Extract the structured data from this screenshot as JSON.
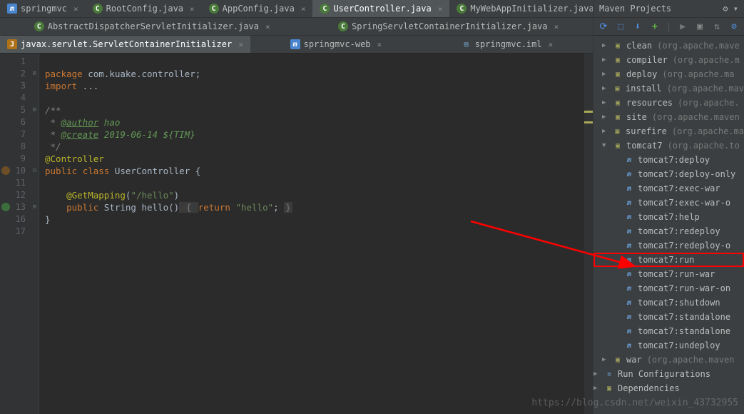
{
  "tabs_row1": [
    {
      "icon": "m",
      "label": "springmvc",
      "active": false,
      "close": true
    },
    {
      "icon": "c",
      "label": "RootConfig.java",
      "active": false,
      "close": true
    },
    {
      "icon": "c",
      "label": "AppConfig.java",
      "active": false,
      "close": true
    },
    {
      "icon": "c",
      "label": "UserController.java",
      "active": true,
      "close": true
    },
    {
      "icon": "c",
      "label": "MyWebAppInitializer.java",
      "active": false,
      "close": true
    }
  ],
  "tabs_row2": [
    {
      "icon": "c",
      "label": "AbstractDispatcherServletInitializer.java",
      "active": false,
      "close": true
    },
    {
      "icon": "c",
      "label": "SpringServletContainerInitializer.java",
      "active": false,
      "close": true
    }
  ],
  "tabs_row3": [
    {
      "icon": "j",
      "label": "javax.servlet.ServletContainerInitializer",
      "active": true,
      "close": true
    },
    {
      "icon": "m",
      "label": "springmvc-web",
      "active": false,
      "close": true
    },
    {
      "icon": "f",
      "label": "springmvc.iml",
      "active": false,
      "close": true
    }
  ],
  "code": {
    "l1_kw": "package",
    "l1_rest": " com.kuake.controller;",
    "l3_kw": "import",
    "l3_rest": " ...",
    "l5": "/**",
    "l6_pre": " * ",
    "l6_tag": "@author",
    "l6_val": " hao",
    "l7_pre": " * ",
    "l7_tag": "@create",
    "l7_val": " 2019-06-14 ${TIM}",
    "l8": " */",
    "l9": "@Controller",
    "l10_kw1": "public",
    "l10_kw2": "class",
    "l10_name": "UserController",
    "l10_brace": " {",
    "l12_ann": "@GetMapping",
    "l12_args": "(\"/hello\")",
    "l13_kw1": "public",
    "l13_ret": "String",
    "l13_name": "hello",
    "l13_p": "()",
    "l13_b1": " { ",
    "l13_kw2": "return",
    "l13_str": " \"hello\"",
    "l13_sc": "; ",
    "l13_b2": "}",
    "l16": "}"
  },
  "lines": [
    "1",
    "2",
    "3",
    "4",
    "5",
    "6",
    "7",
    "8",
    "9",
    "10",
    "11",
    "12",
    "13",
    "16",
    "17"
  ],
  "maven": {
    "title": "Maven Projects",
    "tools_gear": "⚙",
    "items": [
      {
        "indent": 0,
        "arrow": "▶",
        "icon": "pkg",
        "label": "clean",
        "pkg": "(org.apache.mave"
      },
      {
        "indent": 0,
        "arrow": "▶",
        "icon": "pkg",
        "label": "compiler",
        "pkg": "(org.apache.m"
      },
      {
        "indent": 0,
        "arrow": "▶",
        "icon": "pkg",
        "label": "deploy",
        "pkg": "(org.apache.ma"
      },
      {
        "indent": 0,
        "arrow": "▶",
        "icon": "pkg",
        "label": "install",
        "pkg": "(org.apache.mav"
      },
      {
        "indent": 0,
        "arrow": "▶",
        "icon": "pkg",
        "label": "resources",
        "pkg": "(org.apache."
      },
      {
        "indent": 0,
        "arrow": "▶",
        "icon": "pkg",
        "label": "site",
        "pkg": "(org.apache.maven"
      },
      {
        "indent": 0,
        "arrow": "▶",
        "icon": "pkg",
        "label": "surefire",
        "pkg": "(org.apache.ma"
      },
      {
        "indent": 0,
        "arrow": "▼",
        "icon": "pkg",
        "label": "tomcat7",
        "pkg": "(org.apache.to"
      },
      {
        "indent": 1,
        "arrow": "",
        "icon": "m",
        "label": "tomcat7:deploy",
        "pkg": ""
      },
      {
        "indent": 1,
        "arrow": "",
        "icon": "m",
        "label": "tomcat7:deploy-only",
        "pkg": ""
      },
      {
        "indent": 1,
        "arrow": "",
        "icon": "m",
        "label": "tomcat7:exec-war",
        "pkg": ""
      },
      {
        "indent": 1,
        "arrow": "",
        "icon": "m",
        "label": "tomcat7:exec-war-o",
        "pkg": ""
      },
      {
        "indent": 1,
        "arrow": "",
        "icon": "m",
        "label": "tomcat7:help",
        "pkg": ""
      },
      {
        "indent": 1,
        "arrow": "",
        "icon": "m",
        "label": "tomcat7:redeploy",
        "pkg": ""
      },
      {
        "indent": 1,
        "arrow": "",
        "icon": "m",
        "label": "tomcat7:redeploy-o",
        "pkg": ""
      },
      {
        "indent": 1,
        "arrow": "",
        "icon": "m",
        "label": "tomcat7:run",
        "pkg": "",
        "highlight": true
      },
      {
        "indent": 1,
        "arrow": "",
        "icon": "m",
        "label": "tomcat7:run-war",
        "pkg": ""
      },
      {
        "indent": 1,
        "arrow": "",
        "icon": "m",
        "label": "tomcat7:run-war-on",
        "pkg": ""
      },
      {
        "indent": 1,
        "arrow": "",
        "icon": "m",
        "label": "tomcat7:shutdown",
        "pkg": ""
      },
      {
        "indent": 1,
        "arrow": "",
        "icon": "m",
        "label": "tomcat7:standalone",
        "pkg": ""
      },
      {
        "indent": 1,
        "arrow": "",
        "icon": "m",
        "label": "tomcat7:standalone",
        "pkg": ""
      },
      {
        "indent": 1,
        "arrow": "",
        "icon": "m",
        "label": "tomcat7:undeploy",
        "pkg": ""
      },
      {
        "indent": 0,
        "arrow": "▶",
        "icon": "pkg",
        "label": "war",
        "pkg": "(org.apache.maven"
      },
      {
        "indent": -1,
        "arrow": "▶",
        "icon": "gear",
        "label": "Run Configurations",
        "pkg": ""
      },
      {
        "indent": -1,
        "arrow": "▶",
        "icon": "pkg",
        "label": "Dependencies",
        "pkg": ""
      }
    ]
  },
  "watermark": "https://blog.csdn.net/weixin_43732955"
}
